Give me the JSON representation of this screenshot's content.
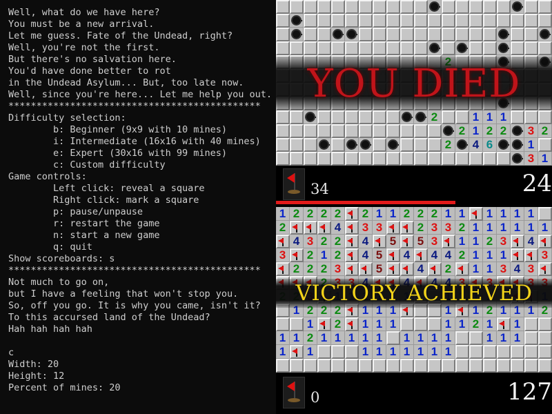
{
  "terminal": {
    "lines": [
      "Well, what do we have here?",
      "You must be a new arrival.",
      "Let me guess. Fate of the Undead, right?",
      "Well, you're not the first.",
      "But there's no salvation here.",
      "You'd have done better to rot",
      "in the Undead Asylum... But, too late now.",
      "Well, since you're here... Let me help you out.",
      "*********************************************",
      "Difficulty selection:",
      "        b: Beginner (9x9 with 10 mines)",
      "        i: Intermediate (16x16 with 40 mines)",
      "        e: Expert (30x16 with 99 mines)",
      "        c: Custom difficulty",
      "Game controls:",
      "        Left click: reveal a square",
      "        Right click: mark a square",
      "        p: pause/unpause",
      "        r: restart the game",
      "        n: start a new game",
      "        q: quit",
      "Show scoreboards: s",
      "*********************************************",
      "Not much to go on,",
      "but I have a feeling that won't stop you.",
      "So, off you go. It is why you came, isn't it?",
      "To this accursed land of the Undead?",
      "Hah hah hah hah",
      "",
      "c",
      "Width: 20",
      "Height: 12",
      "Percent of mines: 20"
    ]
  },
  "game_over_panel": {
    "banner_text": "YOU DIED",
    "mines_remaining": "34",
    "timer": "24",
    "banner_color": "#c0141a",
    "rows": [
      "...........m.....m..",
      ".m..................",
      ".m..mm..........m..m",
      "...........m.m..m...",
      "............2...m..m",
      "....................",
      "....................",
      "................m...",
      "..m......mm2..111...",
      "............m2122m32",
      "...m.mm.m...2m46mm1.",
      ".................m31"
    ]
  },
  "victory_panel": {
    "banner_text": "VICTORY ACHIEVED",
    "mines_remaining": "0",
    "timer": "127",
    "banner_color": "#f1d21a",
    "rows": [
      "12222f21122211f1111.",
      "2fff4f33ff2332111111",
      "f4322f4f5f53f1123f4f",
      "3f212f45f4f442111ff3",
      "f2223ff5ff4f2f11343f",
      "fff2334ff4f443f3ff33",
      "223f111111..11112ff1",
      ".1222f111f..1f121112",
      "..1f2f111...1121f1..",
      "11211111.1111..111..",
      "1f1...1111111.......",
      "...................."
    ]
  },
  "colors": {
    "progress": "#e21a1a",
    "terminal_bg": "#0c0c0c",
    "terminal_text": "#cfcfcf"
  },
  "progress_fraction": 0.65
}
